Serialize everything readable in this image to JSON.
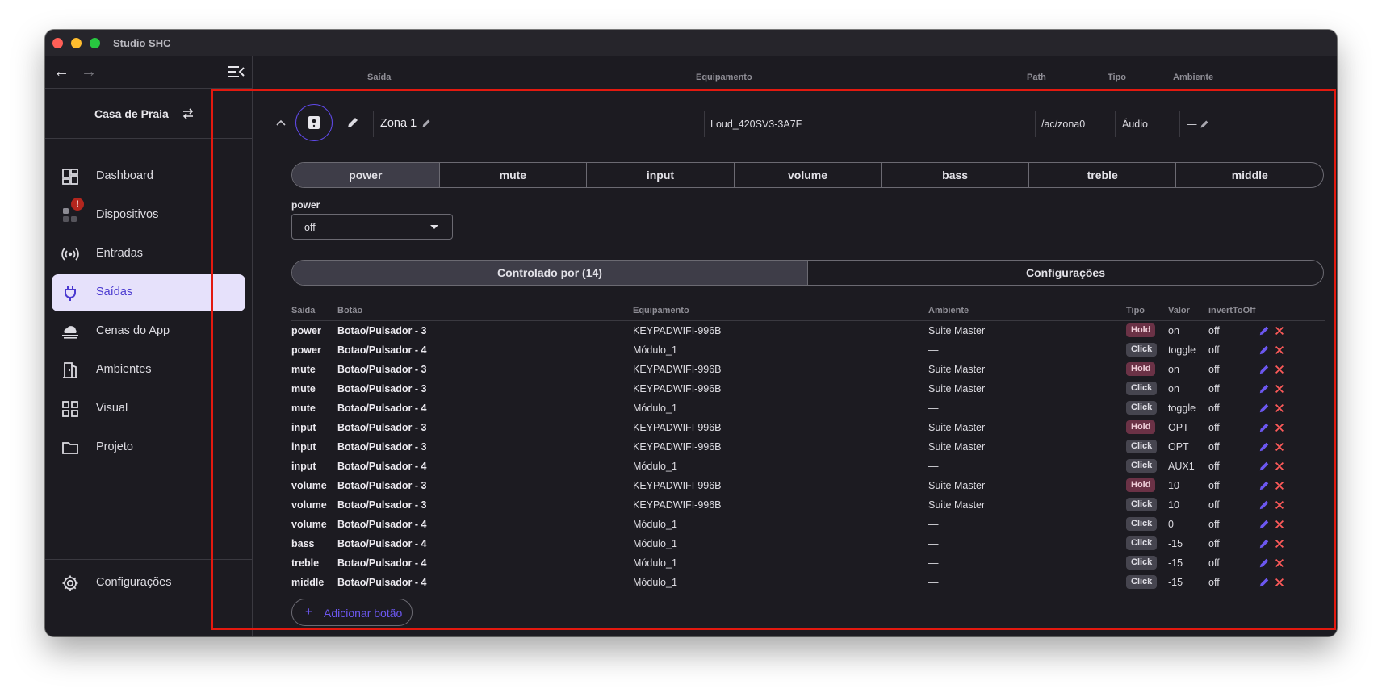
{
  "window": {
    "title": "Studio SHC"
  },
  "sidebar": {
    "project_name": "Casa de Praia",
    "items": [
      {
        "label": "Dashboard",
        "icon": "dashboard-icon",
        "active": false
      },
      {
        "label": "Dispositivos",
        "icon": "devices-icon",
        "active": false,
        "badge": "!"
      },
      {
        "label": "Entradas",
        "icon": "broadcast-icon",
        "active": false
      },
      {
        "label": "Saídas",
        "icon": "plug-icon",
        "active": true
      },
      {
        "label": "Cenas do App",
        "icon": "scene-icon",
        "active": false
      },
      {
        "label": "Ambientes",
        "icon": "door-icon",
        "active": false
      },
      {
        "label": "Visual",
        "icon": "grid-icon",
        "active": false
      },
      {
        "label": "Projeto",
        "icon": "folder-icon",
        "active": false
      }
    ],
    "settings_label": "Configurações"
  },
  "outputs_header": {
    "col_saida": "Saída",
    "col_equipamento": "Equipamento",
    "col_path": "Path",
    "col_tipo": "Tipo",
    "col_ambiente": "Ambiente"
  },
  "zone": {
    "name": "Zona 1",
    "equipment": "Loud_420SV3-3A7F",
    "path": "/ac/zona0",
    "type": "Áudio",
    "ambiente": "—"
  },
  "commands": {
    "tabs": [
      "power",
      "mute",
      "input",
      "volume",
      "bass",
      "treble",
      "middle"
    ],
    "selected": "power"
  },
  "power_field": {
    "label": "power",
    "value": "off"
  },
  "sub_tabs": {
    "controlled_by": "Controlado por (14)",
    "settings": "Configurações"
  },
  "table": {
    "headers": {
      "saida": "Saída",
      "botao": "Botão",
      "equipamento": "Equipamento",
      "ambiente": "Ambiente",
      "tipo": "Tipo",
      "valor": "Valor",
      "invert": "invertToOff"
    },
    "rows": [
      {
        "saida": "power",
        "botao": "Botao/Pulsador - 3",
        "equipamento": "KEYPADWIFI-996B",
        "ambiente": "Suite Master",
        "tipo": "Hold",
        "valor": "on",
        "invert": "off"
      },
      {
        "saida": "power",
        "botao": "Botao/Pulsador - 4",
        "equipamento": "Módulo_1",
        "ambiente": "—",
        "tipo": "Click",
        "valor": "toggle",
        "invert": "off"
      },
      {
        "saida": "mute",
        "botao": "Botao/Pulsador - 3",
        "equipamento": "KEYPADWIFI-996B",
        "ambiente": "Suite Master",
        "tipo": "Hold",
        "valor": "on",
        "invert": "off"
      },
      {
        "saida": "mute",
        "botao": "Botao/Pulsador - 3",
        "equipamento": "KEYPADWIFI-996B",
        "ambiente": "Suite Master",
        "tipo": "Click",
        "valor": "on",
        "invert": "off"
      },
      {
        "saida": "mute",
        "botao": "Botao/Pulsador - 4",
        "equipamento": "Módulo_1",
        "ambiente": "—",
        "tipo": "Click",
        "valor": "toggle",
        "invert": "off"
      },
      {
        "saida": "input",
        "botao": "Botao/Pulsador - 3",
        "equipamento": "KEYPADWIFI-996B",
        "ambiente": "Suite Master",
        "tipo": "Hold",
        "valor": "OPT",
        "invert": "off"
      },
      {
        "saida": "input",
        "botao": "Botao/Pulsador - 3",
        "equipamento": "KEYPADWIFI-996B",
        "ambiente": "Suite Master",
        "tipo": "Click",
        "valor": "OPT",
        "invert": "off"
      },
      {
        "saida": "input",
        "botao": "Botao/Pulsador - 4",
        "equipamento": "Módulo_1",
        "ambiente": "—",
        "tipo": "Click",
        "valor": "AUX1",
        "invert": "off"
      },
      {
        "saida": "volume",
        "botao": "Botao/Pulsador - 3",
        "equipamento": "KEYPADWIFI-996B",
        "ambiente": "Suite Master",
        "tipo": "Hold",
        "valor": "10",
        "invert": "off"
      },
      {
        "saida": "volume",
        "botao": "Botao/Pulsador - 3",
        "equipamento": "KEYPADWIFI-996B",
        "ambiente": "Suite Master",
        "tipo": "Click",
        "valor": "10",
        "invert": "off"
      },
      {
        "saida": "volume",
        "botao": "Botao/Pulsador - 4",
        "equipamento": "Módulo_1",
        "ambiente": "—",
        "tipo": "Click",
        "valor": "0",
        "invert": "off"
      },
      {
        "saida": "bass",
        "botao": "Botao/Pulsador - 4",
        "equipamento": "Módulo_1",
        "ambiente": "—",
        "tipo": "Click",
        "valor": "-15",
        "invert": "off"
      },
      {
        "saida": "treble",
        "botao": "Botao/Pulsador - 4",
        "equipamento": "Módulo_1",
        "ambiente": "—",
        "tipo": "Click",
        "valor": "-15",
        "invert": "off"
      },
      {
        "saida": "middle",
        "botao": "Botao/Pulsador - 4",
        "equipamento": "Módulo_1",
        "ambiente": "—",
        "tipo": "Click",
        "valor": "-15",
        "invert": "off"
      }
    ]
  },
  "add_button_label": "Adicionar botão",
  "colors": {
    "accent": "#5f49e8",
    "active_nav_bg": "#e6e1fb",
    "highlight_frame": "#e3190f",
    "hold_chip": "#6b3246",
    "click_chip": "#46454f"
  }
}
